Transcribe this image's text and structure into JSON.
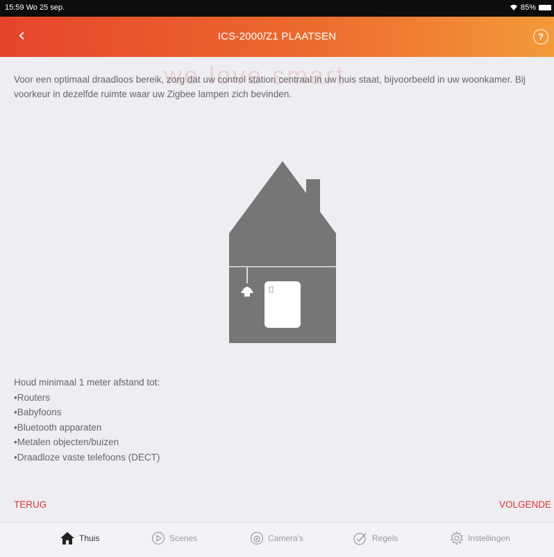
{
  "status": {
    "time": "15:59",
    "date": "Wo 25 sep.",
    "battery": "85%"
  },
  "nav": {
    "back_icon": "chevron-left-icon",
    "title": "ICS-2000/Z1 PLAATSEN",
    "help_icon": "help-icon",
    "help": "?"
  },
  "watermark": "we love smart",
  "intro": "Voor een optimaal draadloos bereik, zorg dat uw control station centraal in uw huis staat, bijvoorbeeld in uw woonkamer. Bij voorkeur in dezelfde ruimte waar uw Zigbee lampen zich bevinden.",
  "tips": {
    "heading": "Houd minimaal 1 meter afstand tot:",
    "items": [
      "Routers",
      "Babyfoons",
      "Bluetooth apparaten",
      "Metalen objecten/buizen",
      "Draadloze vaste telefoons (DECT)"
    ]
  },
  "footer": {
    "back": "TERUG",
    "next": "VOLGENDE"
  },
  "tabbar": [
    {
      "label": "Thuis",
      "icon": "home-icon",
      "active": true
    },
    {
      "label": "Scenes",
      "icon": "play-icon"
    },
    {
      "label": "Camera's",
      "icon": "camera-icon"
    },
    {
      "label": "Regels",
      "icon": "rules-icon"
    },
    {
      "label": "Instellingen",
      "icon": "gear-icon"
    }
  ],
  "colors": {
    "accent": "#d8342c",
    "nav_start": "#e5452b",
    "nav_end": "#f39a3a",
    "house": "#767676"
  }
}
